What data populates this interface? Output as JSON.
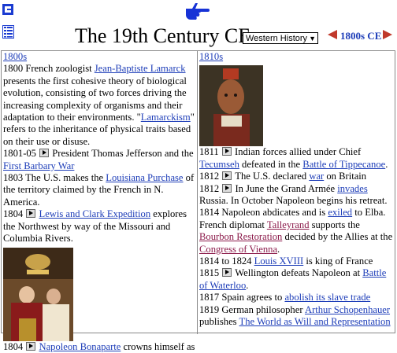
{
  "header": {
    "title": "The 19th Century CE",
    "dropdown_value": "Western History",
    "nav_label": "1800s CE"
  },
  "left": {
    "heading": "1800s",
    "e1_pre": "1800 French zoologist ",
    "e1_link": "Jean-Baptiste Lamarck",
    "e1_mid": " presents the first cohesive theory of biological evolution, consisting of two forces driving the increasing complexity of organisms and their adaptation to their environments. \"",
    "e1_link2": "Lamarckism",
    "e1_post": "\" refers to the inheritance of physical traits based on their use or disuse.",
    "e2_pre": "1801-05 ",
    "e2_mid": " President Thomas Jefferson and the ",
    "e2_link": "First Barbary War",
    "e3_pre": "1803 The U.S. makes the ",
    "e3_link": "Louisiana Purchase",
    "e3_post": " of the territory claimed by the French in N. America.",
    "e4_pre": "1804 ",
    "e4_link": "Lewis and Clark Expedition",
    "e4_post": " explores the Northwest by way of the Missouri and Columbia Rivers.",
    "e5_pre": "1804 ",
    "e5_link": "Napoleon Bonaparte",
    "e5_post": " crowns himself as"
  },
  "right": {
    "heading": "1810s",
    "r1_pre": "1811 ",
    "r1_mid": " Indian forces allied under Chief ",
    "r1_link": "Tecumseh",
    "r1_mid2": " defeated in the ",
    "r1_link2": "Battle of Tippecanoe",
    "r1_post": ".",
    "r2_pre": "1812 ",
    "r2_mid": " The U.S. declared ",
    "r2_link": "war",
    "r2_post": " on Britain",
    "r3_pre": "1812 ",
    "r3_mid": " In June the Grand Armée ",
    "r3_link": "invades",
    "r3_post": " Russia. In October Napoleon begins his retreat.",
    "r4_pre": "1814 Napoleon abdicates and is ",
    "r4_link": "exiled",
    "r4_mid": " to Elba. French diplomat ",
    "r4_link2": "Talleyrand",
    "r4_mid2": " supports the ",
    "r4_link3": "Bourbon Restoration",
    "r4_mid3": " decided by the Allies at the ",
    "r4_link4": "Congress of Vienna",
    "r4_post": ".",
    "r5_pre": "1814 to 1824 ",
    "r5_link": "Louis XVIII",
    "r5_post": " is king of France",
    "r6_pre": "1815 ",
    "r6_mid": " Wellington defeats Napoleon at ",
    "r6_link": "Battle of Waterloo",
    "r6_post": ".",
    "r7_pre": "1817 Spain agrees to ",
    "r7_link": "abolish its slave trade",
    "r8_pre": "1819 German philosopher ",
    "r8_link": "Arthur Schopenhauer",
    "r8_mid": " publishes ",
    "r8_link2": "The World as Will and Representation"
  },
  "colors": {
    "link": "#1d3db8",
    "visited": "#8b1a4a",
    "arrow": "#c0392b",
    "hand": "#1733d6"
  }
}
